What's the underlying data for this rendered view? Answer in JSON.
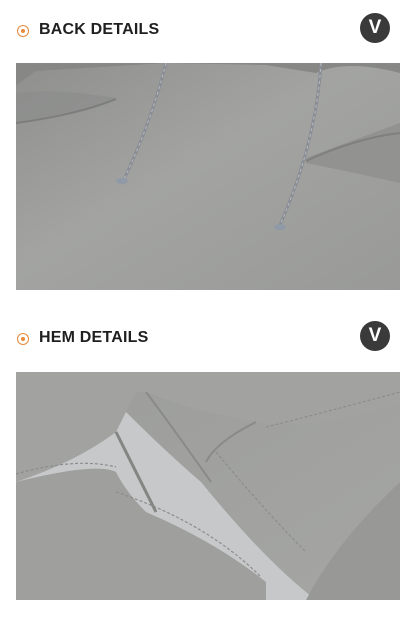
{
  "sections": [
    {
      "title": "BACK DETAILS",
      "badge": "V"
    },
    {
      "title": "HEM DETAILS",
      "badge": "V"
    }
  ],
  "colors": {
    "accent": "#e8893a",
    "badge_bg": "#3a3a3a",
    "fabric": "#9b9c9a",
    "background": "#ffffff"
  }
}
